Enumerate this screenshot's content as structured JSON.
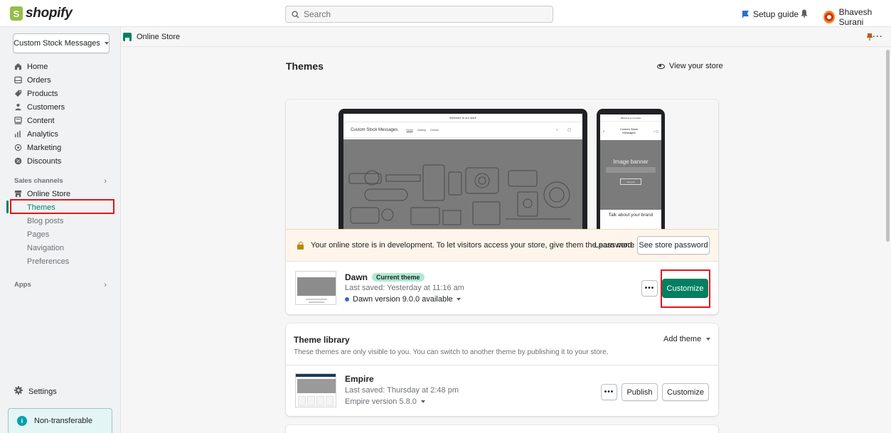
{
  "topbar": {
    "logo_text": "shopify",
    "logo_icon": "shopify-bag-icon",
    "search_placeholder": "Search",
    "setup_guide": "Setup guide",
    "user_name": "Bhavesh Surani"
  },
  "sidebar": {
    "store_selector": "Custom Stock Messages",
    "items": [
      {
        "label": "Home",
        "icon": "home-icon"
      },
      {
        "label": "Orders",
        "icon": "orders-icon"
      },
      {
        "label": "Products",
        "icon": "tag-icon"
      },
      {
        "label": "Customers",
        "icon": "person-icon"
      },
      {
        "label": "Content",
        "icon": "content-icon"
      },
      {
        "label": "Analytics",
        "icon": "bar-chart-icon"
      },
      {
        "label": "Marketing",
        "icon": "target-icon"
      },
      {
        "label": "Discounts",
        "icon": "discount-icon"
      }
    ],
    "sales_channels_label": "Sales channels",
    "online_store_label": "Online Store",
    "subitems": [
      "Themes",
      "Blog posts",
      "Pages",
      "Navigation",
      "Preferences"
    ],
    "active_subitem": "Themes",
    "apps_label": "Apps",
    "settings_label": "Settings",
    "non_transferable": "Non-transferable"
  },
  "breadcrumb": {
    "label": "Online Store"
  },
  "main": {
    "title": "Themes",
    "view_store": "View your store",
    "preview": {
      "announcement": "Welcome to our store",
      "store_name": "Custom Stock Messages",
      "nav": [
        "Home",
        "Catalog",
        "Contact"
      ],
      "phone_store_name": "Custom Stock Messages",
      "banner_title": "Image banner",
      "banner_button": "Shop all",
      "talk_text": "Talk about your brand"
    },
    "password_banner": {
      "text": "Your online store is in development. To let visitors access your store, give them the password.",
      "learn_more": "Learn more",
      "button": "See store password"
    },
    "current_theme": {
      "name": "Dawn",
      "badge": "Current theme",
      "saved": "Last saved: Yesterday at 11:16 am",
      "version": "Dawn version 9.0.0 available",
      "more": "•••",
      "customize": "Customize"
    },
    "library": {
      "title": "Theme library",
      "subtitle": "These themes are only visible to you. You can switch to another theme by publishing it to your store.",
      "add_theme": "Add theme",
      "themes": [
        {
          "name": "Empire",
          "saved": "Last saved: Thursday at 2:48 pm",
          "version": "Empire version 5.8.0",
          "more": "•••",
          "publish": "Publish",
          "customize": "Customize"
        }
      ]
    }
  },
  "colors": {
    "primary_green": "#008060",
    "highlight_red": "#e8121c",
    "banner_bg": "#fff5ea",
    "badge_bg": "#aee9d1"
  }
}
